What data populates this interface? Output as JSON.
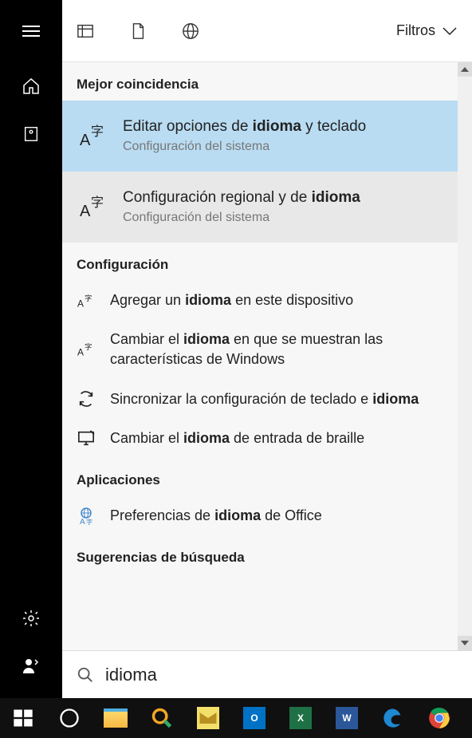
{
  "rail": {
    "items": [
      "menu",
      "home",
      "recent",
      "settings",
      "user"
    ]
  },
  "header": {
    "filters_label": "Filtros"
  },
  "sections": {
    "best_match": "Mejor coincidencia",
    "settings": "Configuración",
    "apps": "Aplicaciones",
    "search_suggestions": "Sugerencias de búsqueda"
  },
  "best": [
    {
      "title_pre": "Editar opciones de ",
      "title_term": "idioma",
      "title_post": " y teclado",
      "subtitle": "Configuración del sistema"
    },
    {
      "title_pre": "Configuración regional y de ",
      "title_term": "idioma",
      "title_post": "",
      "subtitle": "Configuración del sistema"
    }
  ],
  "settings_items": [
    {
      "pre": "Agregar un ",
      "term": "idioma",
      "post": " en este dispositivo",
      "icon": "language"
    },
    {
      "pre": "Cambiar el ",
      "term": "idioma",
      "post": " en que se muestran las características de Windows",
      "icon": "language"
    },
    {
      "pre": "Sincronizar la configuración de teclado e ",
      "term": "idioma",
      "post": "",
      "icon": "sync"
    },
    {
      "pre": "Cambiar el ",
      "term": "idioma",
      "post": " de entrada de braille",
      "icon": "display"
    }
  ],
  "apps_items": [
    {
      "pre": "Preferencias de ",
      "term": "idioma",
      "post": " de Office",
      "icon": "office-lang"
    }
  ],
  "search": {
    "value": "idioma"
  },
  "taskbar": {
    "items": [
      "start",
      "cortana",
      "explorer",
      "search-ask",
      "store",
      "outlook",
      "excel",
      "word",
      "edge",
      "chrome"
    ]
  }
}
